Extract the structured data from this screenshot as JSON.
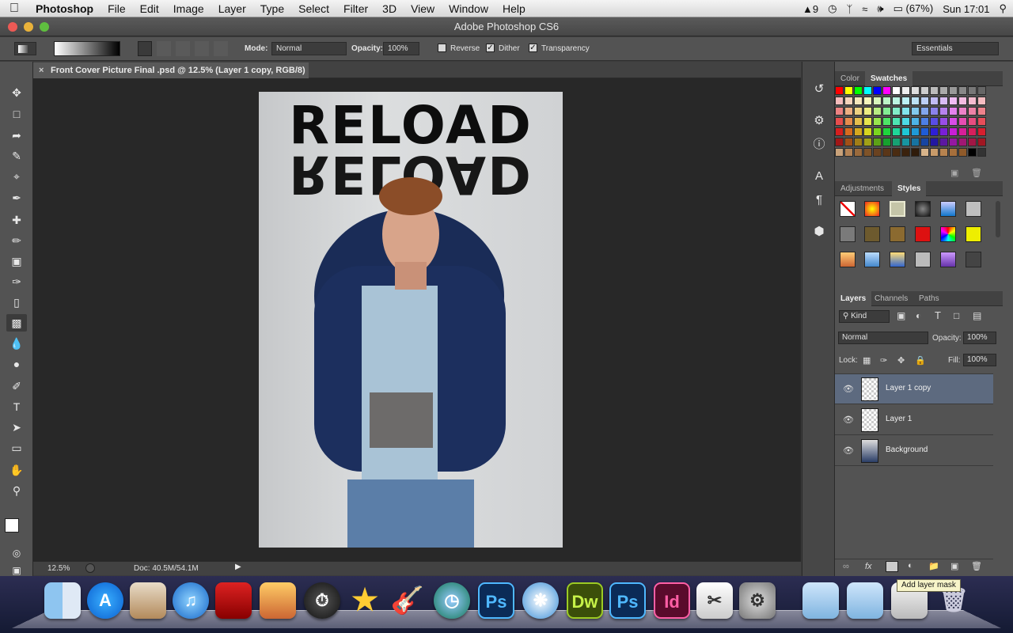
{
  "menubar": {
    "app": "Photoshop",
    "items": [
      "File",
      "Edit",
      "Image",
      "Layer",
      "Type",
      "Select",
      "Filter",
      "3D",
      "View",
      "Window",
      "Help"
    ],
    "status": {
      "adobe_badge": "9",
      "battery": "(67%)",
      "clock": "Sun 17:01"
    }
  },
  "window": {
    "title": "Adobe Photoshop CS6"
  },
  "options": {
    "mode_label": "Mode:",
    "mode_value": "Normal",
    "opacity_label": "Opacity:",
    "opacity_value": "100%",
    "reverse": "Reverse",
    "dither": "Dither",
    "transparency": "Transparency",
    "workspace": "Essentials"
  },
  "document": {
    "tab_title": "Front Cover Picture Final .psd @ 12.5% (Layer 1 copy, RGB/8) *",
    "artwork_text": "RELOAD"
  },
  "statusbar": {
    "zoom": "12.5%",
    "doc_size": "Doc: 40.5M/54.1M"
  },
  "panels": {
    "color_tabs": [
      "Color",
      "Swatches"
    ],
    "style_tabs": [
      "Adjustments",
      "Styles"
    ],
    "layer_tabs": [
      "Layers",
      "Channels",
      "Paths"
    ],
    "kind_label": "Kind",
    "blend_mode": "Normal",
    "opacity_label": "Opacity:",
    "opacity_value": "100%",
    "lock_label": "Lock:",
    "fill_label": "Fill:",
    "fill_value": "100%",
    "layers": [
      {
        "name": "Layer 1 copy",
        "selected": true
      },
      {
        "name": "Layer 1",
        "selected": false
      },
      {
        "name": "Background",
        "selected": false
      }
    ]
  },
  "tooltip": "Add layer mask",
  "colors": {
    "accent_selected_layer": "#5d6a7f",
    "panel_bg": "#535353",
    "canvas_bg": "#282828"
  },
  "dock": {
    "icons": [
      "finder-icon",
      "app-store-icon",
      "preview-icon",
      "itunes-icon",
      "photo-booth-icon",
      "iphoto-icon",
      "dashboard-icon",
      "imovie-icon",
      "garageband-icon",
      "time-machine-icon",
      "photoshop-icon",
      "safari-icon",
      "dreamweaver-icon",
      "photoshop-cs6-icon",
      "indesign-icon",
      "script-editor-icon",
      "system-preferences-icon",
      "applications-folder-icon",
      "documents-folder-icon",
      "downloads-stack-icon",
      "trash-icon"
    ],
    "labels": {
      "ps": "Ps",
      "dw": "Dw",
      "ps2": "Ps",
      "id": "Id"
    }
  }
}
